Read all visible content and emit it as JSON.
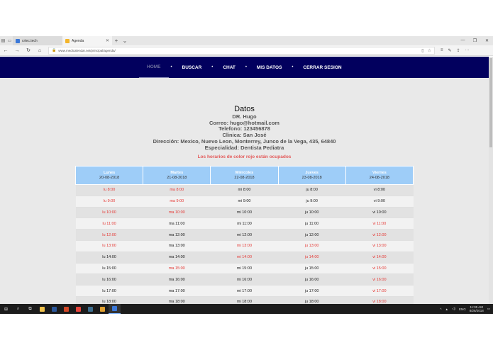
{
  "browser": {
    "tabs": [
      {
        "label": "crtec.tech",
        "active": false,
        "favicon_color": "#3b78d8"
      },
      {
        "label": "Agenda",
        "active": true,
        "favicon_color": "#f3b52b"
      }
    ],
    "url": "www.medicalendar.net/principal/agenda/"
  },
  "nav": {
    "items": [
      {
        "label": "HOME",
        "active": true
      },
      {
        "label": "BUSCAR",
        "active": false
      },
      {
        "label": "CHAT",
        "active": false
      },
      {
        "label": "MIS DATOS",
        "active": false
      },
      {
        "label": "CERRAR SESION",
        "active": false
      }
    ],
    "separator": "•"
  },
  "info": {
    "title": "Datos",
    "lines": [
      "DR. Hugo",
      "Correo: hugo@hotmail.com",
      "Telefono: 123456878",
      "Clinica: San José",
      "Dirección: Mexico, Nuevo Leon, Monterrey, Junco de la Vega, 435, 64840",
      "Especialidad: Dentista Pediatra"
    ],
    "note": "Los horarios de color rojo están ocupados"
  },
  "schedule": {
    "busy_color": "#e53935",
    "header_color": "#9ecdf8",
    "columns": [
      {
        "day": "Lunes",
        "date": "20-08-2018"
      },
      {
        "day": "Martes",
        "date": "21-08-2018"
      },
      {
        "day": "Miércoles",
        "date": "22-08-2018"
      },
      {
        "day": "Jueves",
        "date": "23-08-2018"
      },
      {
        "day": "Viernes",
        "date": "24-08-2018"
      }
    ],
    "rows": [
      [
        {
          "t": "lu 8:00",
          "busy": true
        },
        {
          "t": "ma 8:00",
          "busy": true
        },
        {
          "t": "mi 8:00",
          "busy": false
        },
        {
          "t": "ju 8:00",
          "busy": false
        },
        {
          "t": "vi 8:00",
          "busy": false
        }
      ],
      [
        {
          "t": "lu 9:00",
          "busy": true
        },
        {
          "t": "ma 9:00",
          "busy": true
        },
        {
          "t": "mi 9:00",
          "busy": false
        },
        {
          "t": "ju 9:00",
          "busy": false
        },
        {
          "t": "vi 9:00",
          "busy": false
        }
      ],
      [
        {
          "t": "lu 10:00",
          "busy": true
        },
        {
          "t": "ma 10:00",
          "busy": true
        },
        {
          "t": "mi 10:00",
          "busy": false
        },
        {
          "t": "ju 10:00",
          "busy": false
        },
        {
          "t": "vi 10:00",
          "busy": false
        }
      ],
      [
        {
          "t": "lu 11:00",
          "busy": true
        },
        {
          "t": "ma 11:00",
          "busy": false
        },
        {
          "t": "mi 11:00",
          "busy": false
        },
        {
          "t": "ju 11:00",
          "busy": false
        },
        {
          "t": "vi 11:00",
          "busy": true
        }
      ],
      [
        {
          "t": "lu 12:00",
          "busy": true
        },
        {
          "t": "ma 12:00",
          "busy": false
        },
        {
          "t": "mi 12:00",
          "busy": false
        },
        {
          "t": "ju 12:00",
          "busy": false
        },
        {
          "t": "vi 12:00",
          "busy": true
        }
      ],
      [
        {
          "t": "lu 13:00",
          "busy": true
        },
        {
          "t": "ma 13:00",
          "busy": false
        },
        {
          "t": "mi 13:00",
          "busy": true
        },
        {
          "t": "ju 13:00",
          "busy": true
        },
        {
          "t": "vi 13:00",
          "busy": true
        }
      ],
      [
        {
          "t": "lu 14:00",
          "busy": false
        },
        {
          "t": "ma 14:00",
          "busy": false
        },
        {
          "t": "mi 14:00",
          "busy": true
        },
        {
          "t": "ju 14:00",
          "busy": true
        },
        {
          "t": "vi 14:00",
          "busy": true
        }
      ],
      [
        {
          "t": "lu 15:00",
          "busy": false
        },
        {
          "t": "ma 15:00",
          "busy": true
        },
        {
          "t": "mi 15:00",
          "busy": false
        },
        {
          "t": "ju 15:00",
          "busy": false
        },
        {
          "t": "vi 15:00",
          "busy": true
        }
      ],
      [
        {
          "t": "lu 16:00",
          "busy": false
        },
        {
          "t": "ma 16:00",
          "busy": false
        },
        {
          "t": "mi 16:00",
          "busy": false
        },
        {
          "t": "ju 16:00",
          "busy": false
        },
        {
          "t": "vi 16:00",
          "busy": true
        }
      ],
      [
        {
          "t": "lu 17:00",
          "busy": false
        },
        {
          "t": "ma 17:00",
          "busy": false
        },
        {
          "t": "mi 17:00",
          "busy": false
        },
        {
          "t": "ju 17:00",
          "busy": false
        },
        {
          "t": "vi 17:00",
          "busy": true
        }
      ],
      [
        {
          "t": "lu 18:00",
          "busy": false
        },
        {
          "t": "ma 18:00",
          "busy": false
        },
        {
          "t": "mi 18:00",
          "busy": false
        },
        {
          "t": "ju 18:00",
          "busy": false
        },
        {
          "t": "vi 18:00",
          "busy": true
        }
      ]
    ]
  },
  "taskbar": {
    "apps": [
      {
        "name": "file-explorer-icon",
        "color": "#f0c24b",
        "active": false
      },
      {
        "name": "word-icon",
        "color": "#2b579a",
        "active": false
      },
      {
        "name": "powerpoint-icon",
        "color": "#d24726",
        "active": false
      },
      {
        "name": "chrome-icon",
        "color": "#e8453c",
        "active": false
      },
      {
        "name": "photoshop-icon",
        "color": "#3d6e8f",
        "active": false
      },
      {
        "name": "app-icon",
        "color": "#e0a030",
        "active": false
      },
      {
        "name": "edge-icon",
        "color": "#3b78d8",
        "active": true
      }
    ],
    "lang": "ENG",
    "time": "11:05 AM",
    "date": "8/26/2018"
  }
}
